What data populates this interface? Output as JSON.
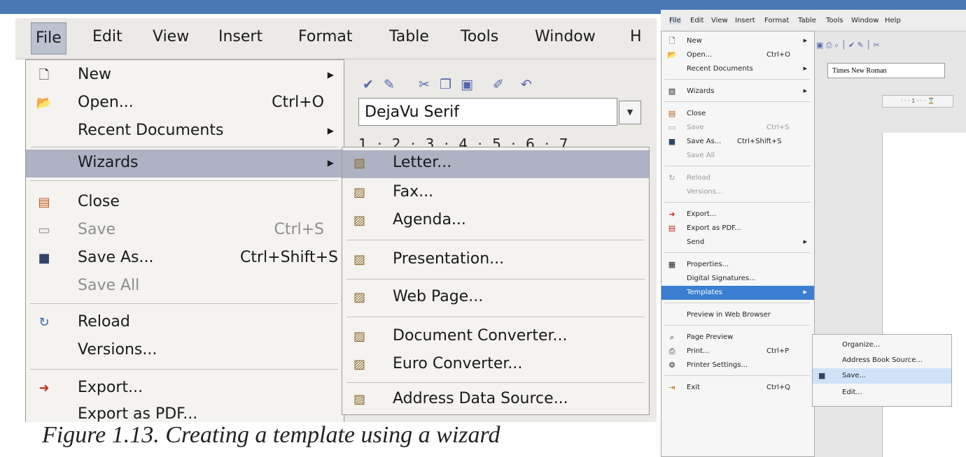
{
  "left_screenshot": {
    "menubar": [
      "File",
      "Edit",
      "View",
      "Insert",
      "Format",
      "Table",
      "Tools",
      "Window",
      "H"
    ],
    "font_name": "DejaVu Serif",
    "ruler": "1 · 2 · 3 · 4 · 5 · 6 · 7",
    "file_menu": [
      {
        "label": "New",
        "shortcut": "",
        "submenu": true
      },
      {
        "label": "Open...",
        "shortcut": "Ctrl+O",
        "submenu": false
      },
      {
        "label": "Recent Documents",
        "shortcut": "",
        "submenu": true
      },
      {
        "label": "Wizards",
        "shortcut": "",
        "submenu": true,
        "highlighted": true
      },
      {
        "label": "Close",
        "shortcut": "",
        "submenu": false
      },
      {
        "label": "Save",
        "shortcut": "Ctrl+S",
        "submenu": false,
        "disabled": true
      },
      {
        "label": "Save As...",
        "shortcut": "Ctrl+Shift+S",
        "submenu": false
      },
      {
        "label": "Save All",
        "shortcut": "",
        "submenu": false,
        "disabled": true
      },
      {
        "label": "Reload",
        "shortcut": "",
        "submenu": false
      },
      {
        "label": "Versions...",
        "shortcut": "",
        "submenu": false
      },
      {
        "label": "Export...",
        "shortcut": "",
        "submenu": false
      },
      {
        "label": "Export as PDF...",
        "shortcut": "",
        "submenu": false
      }
    ],
    "wizards_submenu": [
      {
        "label": "Letter...",
        "highlighted": true
      },
      {
        "label": "Fax..."
      },
      {
        "label": "Agenda..."
      },
      {
        "label": "Presentation..."
      },
      {
        "label": "Web Page..."
      },
      {
        "label": "Document Converter..."
      },
      {
        "label": "Euro Converter..."
      },
      {
        "label": "Address Data Source..."
      }
    ]
  },
  "caption": "Figure 1.13. Creating a template using a wizard",
  "right_screenshot": {
    "menubar": [
      "File",
      "Edit",
      "View",
      "Insert",
      "Format",
      "Table",
      "Tools",
      "Window",
      "Help"
    ],
    "font_name": "Times New Roman",
    "ruler": "· · · 1 · · · ⌛",
    "file_menu": [
      {
        "label": "New",
        "shortcut": "",
        "submenu": true
      },
      {
        "label": "Open...",
        "shortcut": "Ctrl+O",
        "submenu": false
      },
      {
        "label": "Recent Documents",
        "shortcut": "",
        "submenu": true
      },
      {
        "label": "Wizards",
        "shortcut": "",
        "submenu": true
      },
      {
        "label": "Close",
        "shortcut": "",
        "submenu": false
      },
      {
        "label": "Save",
        "shortcut": "Ctrl+S",
        "submenu": false,
        "disabled": true
      },
      {
        "label": "Save As...",
        "shortcut": "Ctrl+Shift+S",
        "submenu": false
      },
      {
        "label": "Save All",
        "shortcut": "",
        "submenu": false,
        "disabled": true
      },
      {
        "label": "Reload",
        "shortcut": "",
        "submenu": false,
        "disabled": true
      },
      {
        "label": "Versions...",
        "shortcut": "",
        "submenu": false,
        "disabled": true
      },
      {
        "label": "Export...",
        "shortcut": "",
        "submenu": false
      },
      {
        "label": "Export as PDF...",
        "shortcut": "",
        "submenu": false
      },
      {
        "label": "Send",
        "shortcut": "",
        "submenu": true
      },
      {
        "label": "Properties...",
        "shortcut": "",
        "submenu": false
      },
      {
        "label": "Digital Signatures...",
        "shortcut": "",
        "submenu": false
      },
      {
        "label": "Templates",
        "shortcut": "",
        "submenu": true,
        "highlighted": true
      },
      {
        "label": "Preview in Web Browser",
        "shortcut": "",
        "submenu": false
      },
      {
        "label": "Page Preview",
        "shortcut": "",
        "submenu": false
      },
      {
        "label": "Print...",
        "shortcut": "Ctrl+P",
        "submenu": false
      },
      {
        "label": "Printer Settings...",
        "shortcut": "",
        "submenu": false
      },
      {
        "label": "Exit",
        "shortcut": "Ctrl+Q",
        "submenu": false
      }
    ],
    "templates_submenu": [
      {
        "label": "Organize..."
      },
      {
        "label": "Address Book Source..."
      },
      {
        "label": "Save...",
        "highlighted": true
      },
      {
        "label": "Edit..."
      }
    ]
  },
  "colors": {
    "top_band": "#4a78b4",
    "left_highlight": "#aeb3c4",
    "right_highlight": "#3b7ed2",
    "right_sub_highlight": "#cfe3f8"
  }
}
